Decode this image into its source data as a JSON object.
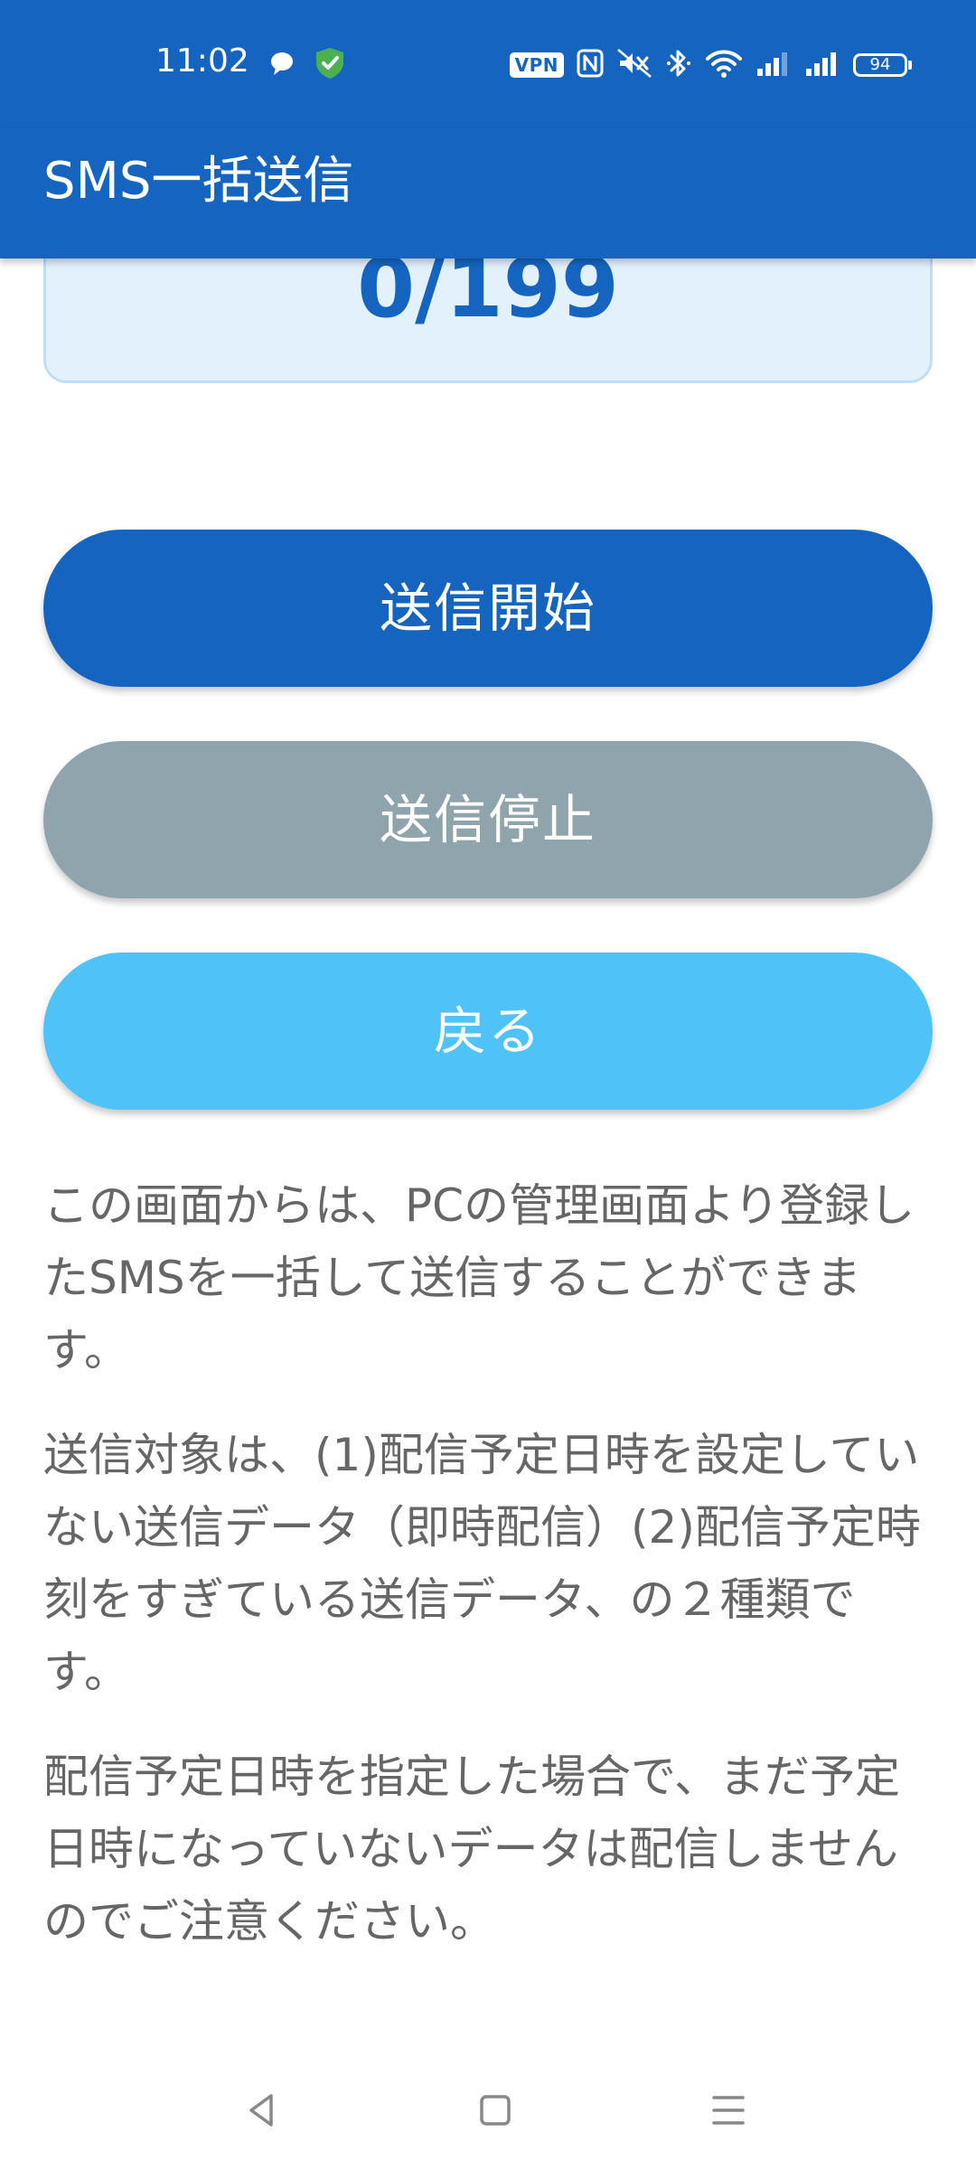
{
  "status_bar": {
    "time": "11:02",
    "vpn_label": "VPN",
    "battery_level": "94",
    "left_icons": [
      "chat-bubble-icon",
      "shield-check-icon"
    ],
    "right_icons": [
      "vpn-icon",
      "nfc-icon",
      "mute-icon",
      "bluetooth-icon",
      "wifi-icon",
      "signal-1-icon",
      "signal-2-icon",
      "battery-icon"
    ]
  },
  "app_bar": {
    "title": "SMS一括送信"
  },
  "counter": {
    "value": "0/199"
  },
  "buttons": {
    "start_label": "送信開始",
    "stop_label": "送信停止",
    "back_label": "戻る"
  },
  "description": {
    "paragraph_1": "この画面からは、PCの管理画面より登録したSMSを一括して送信することができます。",
    "paragraph_2": "送信対象は、(1)配信予定日時を設定していない送信データ（即時配信）(2)配信予定時刻をすぎている送信データ、の２種類です。",
    "paragraph_3": "配信予定日時を指定した場合で、まだ予定日時になっていないデータは配信しませんのでご注意ください。"
  },
  "nav_bar": {
    "icons": [
      "back-triangle-icon",
      "home-square-icon",
      "menu-lines-icon"
    ]
  },
  "colors": {
    "primary": "#1565c0",
    "stop_button": "#90a4ae",
    "back_button": "#4fc3f7",
    "counter_background": "#e3f1fd",
    "body_text": "#666666"
  }
}
